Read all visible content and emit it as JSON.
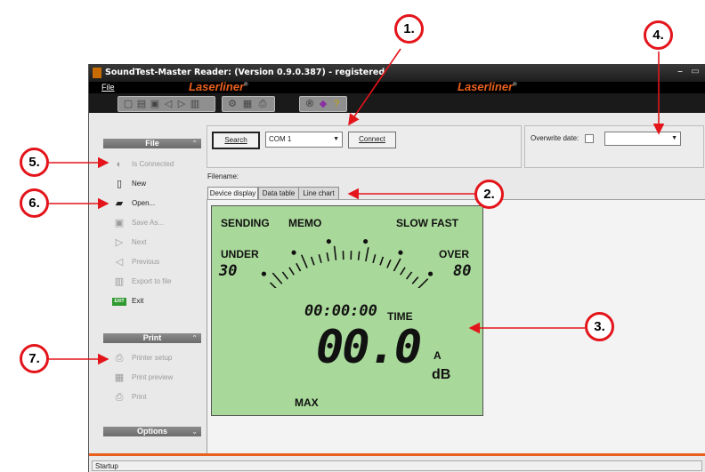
{
  "window": {
    "title": "SoundTest-Master Reader: (Version 0.9.0.387) - registered",
    "menu_file": "File",
    "brand": "Laserliner",
    "brand_mark": "®"
  },
  "sidebar": {
    "file_section": "File",
    "print_section": "Print",
    "options_section": "Options",
    "file_items": [
      {
        "label": "Is Connected",
        "icon": "plug-icon",
        "enabled": false
      },
      {
        "label": "New",
        "icon": "new-document-icon",
        "enabled": true
      },
      {
        "label": "Open...",
        "icon": "open-folder-icon",
        "enabled": true
      },
      {
        "label": "Save As...",
        "icon": "save-icon",
        "enabled": false
      },
      {
        "label": "Next",
        "icon": "next-icon",
        "enabled": false
      },
      {
        "label": "Previous",
        "icon": "previous-icon",
        "enabled": false
      },
      {
        "label": "Export to file",
        "icon": "export-icon",
        "enabled": false
      },
      {
        "label": "Exit",
        "icon": "exit-icon",
        "enabled": true
      }
    ],
    "print_items": [
      {
        "label": "Printer setup",
        "icon": "printer-setup-icon",
        "enabled": false
      },
      {
        "label": "Print preview",
        "icon": "print-preview-icon",
        "enabled": false
      },
      {
        "label": "Print",
        "icon": "print-icon",
        "enabled": false
      }
    ],
    "exit_icon_text": "EXIT"
  },
  "connection": {
    "search_label": "Search",
    "port_value": "COM 1",
    "connect_label": "Connect",
    "overwrite_label": "Overwrite date:",
    "overwrite_value": "",
    "filename_label": "Filename:"
  },
  "tabs": [
    "Device display",
    "Data table",
    "Line chart"
  ],
  "display": {
    "sending": "SENDING",
    "memo": "MEMO",
    "slow_fast": "SLOW FAST",
    "under": "UNDER",
    "over": "OVER",
    "range_low": "30",
    "range_high": "80",
    "time_value": "00:00:00",
    "time_label": "TIME",
    "level_value": "00.0",
    "weighting": "A",
    "unit": "dB",
    "max": "MAX"
  },
  "status": {
    "text": "Startup"
  },
  "callouts": [
    "1.",
    "2.",
    "3.",
    "4.",
    "5.",
    "6.",
    "7."
  ],
  "colors": {
    "callout": "#e3151b",
    "brand": "#e8601c",
    "lcd": "#a9d99a"
  }
}
